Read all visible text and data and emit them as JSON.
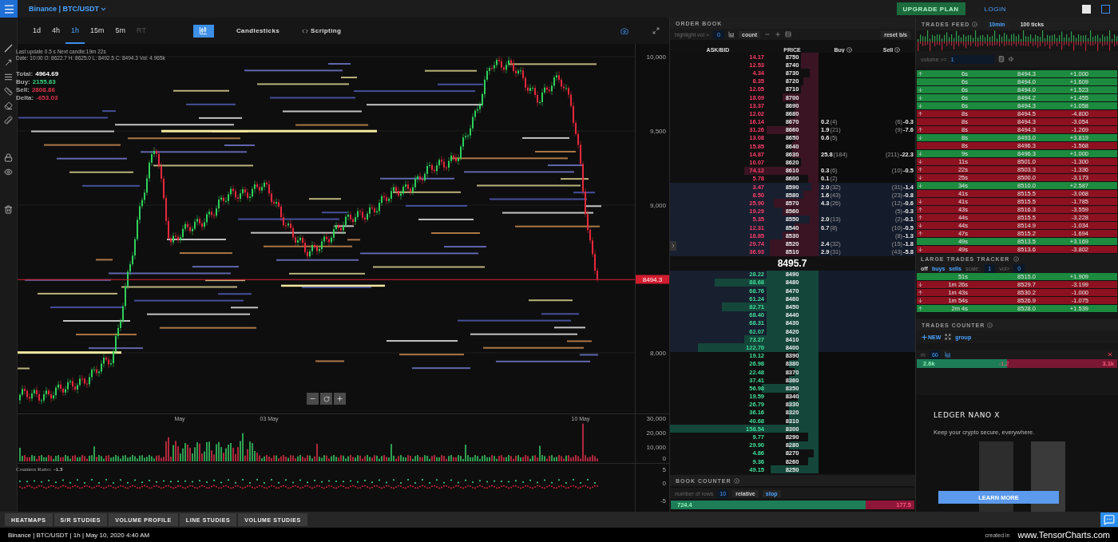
{
  "top_bar": {
    "symbol": "Binance | BTC/USDT",
    "upgrade": "UPGRADE PLAN",
    "login": "LOGIN"
  },
  "chart": {
    "timeframes": [
      {
        "label": "1d",
        "selected": false,
        "disabled": false
      },
      {
        "label": "4h",
        "selected": false,
        "disabled": false
      },
      {
        "label": "1h",
        "selected": true,
        "disabled": false
      },
      {
        "label": "15m",
        "selected": false,
        "disabled": false
      },
      {
        "label": "5m",
        "selected": false,
        "disabled": false
      },
      {
        "label": "RT",
        "selected": false,
        "disabled": true
      }
    ],
    "chart_type": "Candlesticks",
    "scripting": "Scripting",
    "status_line": "Last update 0.5 s  Next candle:19m 22s",
    "ohlc_line": "Date: 10:00 O: 8622.7 H: 8625.0 L: 8492.5 C: 8494.3 Vol: 4.965k",
    "totals": [
      {
        "label": "Total:",
        "value": "4964.69",
        "color": "#ffffff"
      },
      {
        "label": "Buy:",
        "value": "2155.83",
        "color": "#3ad27a"
      },
      {
        "label": "Sell:",
        "value": "2808.86",
        "color": "#e0334f"
      },
      {
        "label": "Delta:",
        "value": "-653.03",
        "color": "#e0334f"
      }
    ],
    "price_axis": [
      "10,000",
      "9,500",
      "9,000",
      "8,000"
    ],
    "last_price": "8494.3",
    "date_axis": [
      "May",
      "03 May",
      "10 May"
    ],
    "volume_axis": [
      "30,000",
      "20,000",
      "10,000",
      "0"
    ],
    "ratio_label": "Counters Ratio:",
    "ratio_value": "-1.3",
    "ratio_axis": [
      "5",
      "0",
      "-5"
    ]
  },
  "order_book": {
    "title": "ORDER BOOK",
    "highlight_label": "highlight vol >",
    "highlight_value": "0",
    "count": "count",
    "reset": "reset b/s",
    "columns": [
      "ASK/BID",
      "PRICE",
      "Buy",
      "Sell"
    ],
    "asks": [
      {
        "amount": "14.17",
        "price": "8750",
        "level": 0.12,
        "highlighted": false
      },
      {
        "amount": "12.53",
        "price": "8740",
        "level": 0.12,
        "highlighted": false
      },
      {
        "amount": "4.34",
        "price": "8730",
        "level": 0.06,
        "highlighted": false
      },
      {
        "amount": "8.35",
        "price": "8720",
        "level": 0.1,
        "highlighted": false
      },
      {
        "amount": "12.05",
        "price": "8710",
        "level": 0.12,
        "highlighted": false
      },
      {
        "amount": "18.09",
        "price": "8700",
        "level": 0.24,
        "highlighted": false
      },
      {
        "amount": "13.37",
        "price": "8690",
        "level": 0.16,
        "highlighted": false
      },
      {
        "amount": "12.02",
        "price": "8680",
        "level": 0.16,
        "highlighted": false
      },
      {
        "amount": "16.14",
        "price": "8670",
        "level": 0.2,
        "highlighted": false,
        "buy": "0.2",
        "buy_count": "(4)",
        "sell": "-0.3",
        "sell_count": "(6)"
      },
      {
        "amount": "31.26",
        "price": "8660",
        "level": 0.35,
        "highlighted": false,
        "buy": "1.9",
        "buy_count": "(21)",
        "sell": "-7.6",
        "sell_count": "(9)"
      },
      {
        "amount": "13.08",
        "price": "8650",
        "level": 0.16,
        "highlighted": false,
        "buy": "0.6",
        "buy_count": "(5)"
      },
      {
        "amount": "15.85",
        "price": "8640",
        "level": 0.18,
        "highlighted": false
      },
      {
        "amount": "14.87",
        "price": "8630",
        "level": 0.18,
        "highlighted": false,
        "buy": "25.8",
        "buy_count": "(184)",
        "sell": "-22.3",
        "sell_count": "(211)"
      },
      {
        "amount": "10.07",
        "price": "8620",
        "level": 0.12,
        "highlighted": false
      },
      {
        "amount": "74.12",
        "price": "8610",
        "level": 0.5,
        "highlighted": false,
        "buy": "0.3",
        "buy_count": "(6)",
        "sell": "-0.5",
        "sell_count": "(10)"
      },
      {
        "amount": "5.78",
        "price": "8600",
        "level": 0.07,
        "highlighted": false,
        "buy": "0.1",
        "buy_count": "(2)"
      },
      {
        "amount": "3.47",
        "price": "8590",
        "level": 0.05,
        "highlighted": true,
        "buy": "2.0",
        "buy_count": "(32)",
        "sell": "-1.4",
        "sell_count": "(31)"
      },
      {
        "amount": "8.50",
        "price": "8580",
        "level": 0.1,
        "highlighted": true,
        "buy": "1.6",
        "buy_count": "(43)",
        "sell": "-0.8",
        "sell_count": "(23)"
      },
      {
        "amount": "25.90",
        "price": "8570",
        "level": 0.3,
        "highlighted": true,
        "buy": "4.3",
        "buy_count": "(26)",
        "sell": "-0.6",
        "sell_count": "(12)"
      },
      {
        "amount": "19.29",
        "price": "8560",
        "level": 0.24,
        "highlighted": true,
        "sell": "-0.3",
        "sell_count": "(5)"
      },
      {
        "amount": "5.35",
        "price": "8550",
        "level": 0.06,
        "highlighted": true,
        "buy": "2.0",
        "buy_count": "(13)",
        "sell": "-0.1",
        "sell_count": "(2)"
      },
      {
        "amount": "12.31",
        "price": "8540",
        "level": 0.16,
        "highlighted": true,
        "buy": "0.7",
        "buy_count": "(8)",
        "sell": "-0.5",
        "sell_count": "(10)"
      },
      {
        "amount": "18.85",
        "price": "8530",
        "level": 0.24,
        "highlighted": true,
        "sell": "-1.3",
        "sell_count": "(8)"
      },
      {
        "amount": "29.74",
        "price": "8520",
        "level": 0.33,
        "highlighted": true,
        "buy": "2.4",
        "buy_count": "(32)",
        "sell": "-1.8",
        "sell_count": "(15)"
      },
      {
        "amount": "36.93",
        "price": "8510",
        "level": 0.33,
        "highlighted": true,
        "buy": "2.9",
        "buy_count": "(31)",
        "sell": "-5.8",
        "sell_count": "(43)"
      }
    ],
    "mid_price": "8495.7",
    "bids": [
      {
        "amount": "28.22",
        "price": "8490",
        "level": 0.35,
        "highlighted": true
      },
      {
        "amount": "88.68",
        "price": "8480",
        "level": 0.7,
        "highlighted": true
      },
      {
        "amount": "68.76",
        "price": "8470",
        "level": 0.35,
        "highlighted": true
      },
      {
        "amount": "61.24",
        "price": "8460",
        "level": 0.35,
        "highlighted": true
      },
      {
        "amount": "82.71",
        "price": "8450",
        "level": 0.65,
        "highlighted": true
      },
      {
        "amount": "68.40",
        "price": "8440",
        "level": 0.35,
        "highlighted": true
      },
      {
        "amount": "68.31",
        "price": "8430",
        "level": 0.35,
        "highlighted": true
      },
      {
        "amount": "62.07",
        "price": "8420",
        "level": 0.35,
        "highlighted": true
      },
      {
        "amount": "73.27",
        "price": "8410",
        "level": 0.5,
        "highlighted": true
      },
      {
        "amount": "122.70",
        "price": "8400",
        "level": 0.81,
        "highlighted": true
      },
      {
        "amount": "19.12",
        "price": "8390",
        "level": 0.14,
        "highlighted": false
      },
      {
        "amount": "26.98",
        "price": "8380",
        "level": 0.2,
        "highlighted": false
      },
      {
        "amount": "22.48",
        "price": "8370",
        "level": 0.16,
        "highlighted": false
      },
      {
        "amount": "37.41",
        "price": "8360",
        "level": 0.2,
        "highlighted": false
      },
      {
        "amount": "56.98",
        "price": "8350",
        "level": 0.38,
        "highlighted": false
      },
      {
        "amount": "19.59",
        "price": "8340",
        "level": 0.14,
        "highlighted": false
      },
      {
        "amount": "26.79",
        "price": "8330",
        "level": 0.2,
        "highlighted": false
      },
      {
        "amount": "36.16",
        "price": "8320",
        "level": 0.2,
        "highlighted": false
      },
      {
        "amount": "40.68",
        "price": "8310",
        "level": 0.2,
        "highlighted": false
      },
      {
        "amount": "158.54",
        "price": "8300",
        "level": 1,
        "highlighted": false
      },
      {
        "amount": "9.77",
        "price": "8290",
        "level": 0.07,
        "highlighted": false
      },
      {
        "amount": "29.90",
        "price": "8280",
        "level": 0.2,
        "highlighted": false
      },
      {
        "amount": "4.86",
        "price": "8270",
        "level": 0.03,
        "highlighted": false
      },
      {
        "amount": "9.36",
        "price": "8260",
        "level": 0.07,
        "highlighted": false
      },
      {
        "amount": "49.15",
        "price": "8250",
        "level": 0.32,
        "highlighted": false
      }
    ],
    "counter_title": "BOOK COUNTER",
    "rows_label": "number of rows",
    "rows_value": "10",
    "relative": "relative",
    "stop": "stop",
    "counter_bar": {
      "buy": "724.4",
      "sell": "177.5",
      "level": 0.8
    }
  },
  "trades_feed": {
    "title": "TRADES FEED",
    "ranges": [
      {
        "label": "10min",
        "selected": true
      },
      {
        "label": "100 ticks",
        "selected": false
      }
    ],
    "volume_label": "volume >=",
    "volume_value": "1",
    "rows": [
      {
        "time": "6s",
        "price": "8494.3",
        "qty": "+1.000",
        "color": "#1c8a3f",
        "kind": "up"
      },
      {
        "time": "6s",
        "price": "8494.0",
        "qty": "+1.609",
        "color": "#1c8a3f",
        "kind": "plain"
      },
      {
        "time": "6s",
        "price": "8494.0",
        "qty": "+1.523",
        "color": "#1c8a3f",
        "kind": "down"
      },
      {
        "time": "6s",
        "price": "8494.2",
        "qty": "+1.455",
        "color": "#1c8a3f",
        "kind": "down"
      },
      {
        "time": "6s",
        "price": "8494.3",
        "qty": "+1.058",
        "color": "#1c8a3f",
        "kind": "down"
      },
      {
        "time": "8s",
        "price": "8494.5",
        "qty": "-4.800",
        "color": "#8d1120",
        "kind": "up"
      },
      {
        "time": "8s",
        "price": "8494.3",
        "qty": "-3.054",
        "color": "#8d1120",
        "kind": "plain"
      },
      {
        "time": "8s",
        "price": "8494.3",
        "qty": "-1.269",
        "color": "#8d1120",
        "kind": "up"
      },
      {
        "time": "8s",
        "price": "8493.0",
        "qty": "+3.819",
        "color": "#1c8a3f",
        "kind": "down"
      },
      {
        "time": "8s",
        "price": "8496.3",
        "qty": "-1.568",
        "color": "#8d1120",
        "kind": "plain"
      },
      {
        "time": "9s",
        "price": "8496.3",
        "qty": "+1.000",
        "color": "#1c8a3f",
        "kind": "down"
      },
      {
        "time": "11s",
        "price": "8501.0",
        "qty": "-1.300",
        "color": "#8d1120",
        "kind": "down"
      },
      {
        "time": "22s",
        "price": "8503.3",
        "qty": "-1.336",
        "color": "#8d1120",
        "kind": "up"
      },
      {
        "time": "25s",
        "price": "8500.0",
        "qty": "-3.173",
        "color": "#8d1120",
        "kind": "down"
      },
      {
        "time": "34s",
        "price": "8510.0",
        "qty": "+2.587",
        "color": "#1c8a3f",
        "kind": "down"
      },
      {
        "time": "41s",
        "price": "8515.5",
        "qty": "-3.068",
        "color": "#8d1120",
        "kind": "plain"
      },
      {
        "time": "41s",
        "price": "8515.5",
        "qty": "-1.785",
        "color": "#8d1120",
        "kind": "down"
      },
      {
        "time": "43s",
        "price": "8516.3",
        "qty": "-3.559",
        "color": "#8d1120",
        "kind": "up"
      },
      {
        "time": "44s",
        "price": "8515.5",
        "qty": "-3.228",
        "color": "#8d1120",
        "kind": "up"
      },
      {
        "time": "44s",
        "price": "8514.9",
        "qty": "-1.034",
        "color": "#8d1120",
        "kind": "down"
      },
      {
        "time": "47s",
        "price": "8515.2",
        "qty": "-1.694",
        "color": "#8d1120",
        "kind": "up"
      },
      {
        "time": "49s",
        "price": "8513.5",
        "qty": "+3.169",
        "color": "#1c8a3f",
        "kind": "plain"
      },
      {
        "time": "49s",
        "price": "8513.6",
        "qty": "-3.802",
        "color": "#8d1120",
        "kind": "down"
      }
    ],
    "rows_below_tracker": [
      {
        "time": "51s",
        "price": "8515.0",
        "qty": "+1.909",
        "color": "#1c8a3f",
        "kind": "plain"
      },
      {
        "time": "1m 26s",
        "price": "8529.7",
        "qty": "-3.199",
        "color": "#8d1120",
        "kind": "down"
      },
      {
        "time": "1m 43s",
        "price": "8530.2",
        "qty": "-1.000",
        "color": "#8d1120",
        "kind": "up"
      },
      {
        "time": "1m 54s",
        "price": "8526.9",
        "qty": "-1.075",
        "color": "#8d1120",
        "kind": "down"
      },
      {
        "time": "2m 4s",
        "price": "8528.0",
        "qty": "+1.539",
        "color": "#1c8a3f",
        "kind": "up"
      }
    ]
  },
  "large_trades_tracker": {
    "title": "LARGE TRADES TRACKER",
    "off": "off",
    "buys": "buys",
    "sells": "sells",
    "scale_label": "scale:",
    "scale_value": "1",
    "vol_label": "vol>",
    "vol_value": "0"
  },
  "trades_counter": {
    "title": "TRADES COUNTER",
    "new": "NEW",
    "group": "group",
    "unit": "m",
    "minutes": "60",
    "buy": "2.6k",
    "delta": "-1.2",
    "sell": "3.1k",
    "level": 0.45
  },
  "ad": {
    "title": "LEDGER NANO X",
    "text": "Keep your crypto secure, everywhere.",
    "button": "LEARN MORE"
  },
  "bottom_tabs": [
    "HEATMAPS",
    "S/R STUDIES",
    "VOLUME PROFILE",
    "LINE STUDIES",
    "VOLUME STUDIES"
  ],
  "status_bar": {
    "text": "Binance | BTC/USDT | 1h | May 10, 2020 4:40 AM",
    "created": "created in",
    "site": "www.TensorCharts.com"
  }
}
